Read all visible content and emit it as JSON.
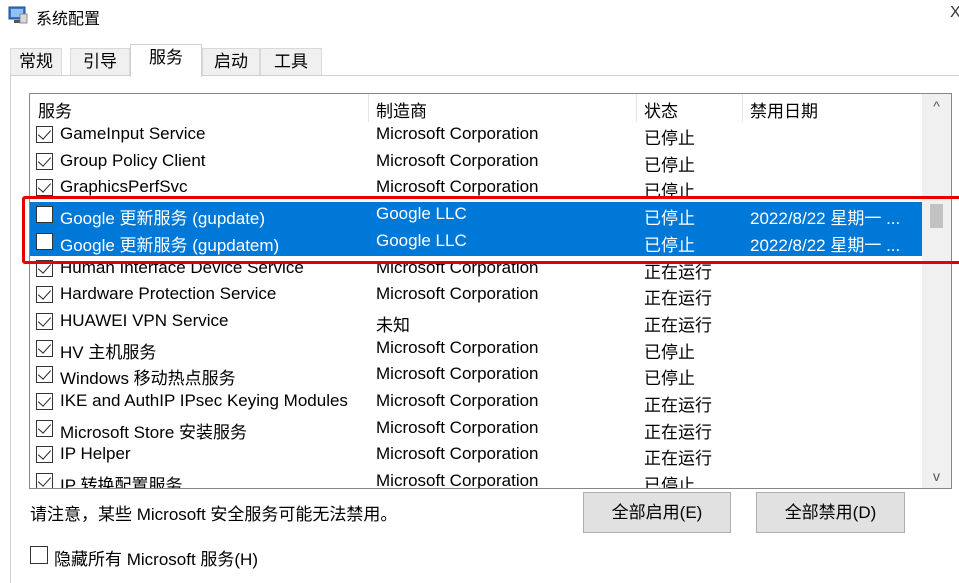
{
  "window": {
    "title": "系统配置",
    "close_glyph": "X"
  },
  "tabs": [
    {
      "label": "常规",
      "active": false
    },
    {
      "label": "引导",
      "active": false
    },
    {
      "label": "服务",
      "active": true
    },
    {
      "label": "启动",
      "active": false
    },
    {
      "label": "工具",
      "active": false
    }
  ],
  "columns": {
    "service": "服务",
    "manufacturer": "制造商",
    "status": "状态",
    "disabled_date": "禁用日期"
  },
  "rows": [
    {
      "checked": true,
      "selected": false,
      "name": "GameInput Service",
      "maker": "Microsoft Corporation",
      "status": "已停止",
      "date": ""
    },
    {
      "checked": true,
      "selected": false,
      "name": "Group Policy Client",
      "maker": "Microsoft Corporation",
      "status": "已停止",
      "date": ""
    },
    {
      "checked": true,
      "selected": false,
      "name": "GraphicsPerfSvc",
      "maker": "Microsoft Corporation",
      "status": "已停止",
      "date": ""
    },
    {
      "checked": false,
      "selected": true,
      "name": "Google 更新服务 (gupdate)",
      "maker": "Google LLC",
      "status": "已停止",
      "date": "2022/8/22 星期一 ..."
    },
    {
      "checked": false,
      "selected": true,
      "name": "Google 更新服务 (gupdatem)",
      "maker": "Google LLC",
      "status": "已停止",
      "date": "2022/8/22 星期一 ..."
    },
    {
      "checked": true,
      "selected": false,
      "name": "Human Interface Device Service",
      "maker": "Microsoft Corporation",
      "status": "正在运行",
      "date": ""
    },
    {
      "checked": true,
      "selected": false,
      "name": "Hardware Protection Service",
      "maker": "Microsoft Corporation",
      "status": "正在运行",
      "date": ""
    },
    {
      "checked": true,
      "selected": false,
      "name": "HUAWEI VPN Service",
      "maker": "未知",
      "status": "正在运行",
      "date": ""
    },
    {
      "checked": true,
      "selected": false,
      "name": "HV 主机服务",
      "maker": "Microsoft Corporation",
      "status": "已停止",
      "date": ""
    },
    {
      "checked": true,
      "selected": false,
      "name": "Windows 移动热点服务",
      "maker": "Microsoft Corporation",
      "status": "已停止",
      "date": ""
    },
    {
      "checked": true,
      "selected": false,
      "name": "IKE and AuthIP IPsec Keying Modules",
      "maker": "Microsoft Corporation",
      "status": "正在运行",
      "date": ""
    },
    {
      "checked": true,
      "selected": false,
      "name": "Microsoft Store 安装服务",
      "maker": "Microsoft Corporation",
      "status": "正在运行",
      "date": ""
    },
    {
      "checked": true,
      "selected": false,
      "name": "IP Helper",
      "maker": "Microsoft Corporation",
      "status": "正在运行",
      "date": ""
    },
    {
      "checked": true,
      "selected": false,
      "name": "IP 转换配置服务",
      "maker": "Microsoft Corporation",
      "status": "已停止",
      "date": ""
    }
  ],
  "scroll": {
    "up_glyph": "^",
    "down_glyph": "v"
  },
  "footer": {
    "notice": "请注意，某些 Microsoft 安全服务可能无法禁用。",
    "enable_all": "全部启用(E)",
    "disable_all": "全部禁用(D)",
    "hide_ms_label": "隐藏所有 Microsoft 服务(H)"
  },
  "colors": {
    "selection": "#0078d7",
    "highlight_border": "#e60000"
  }
}
